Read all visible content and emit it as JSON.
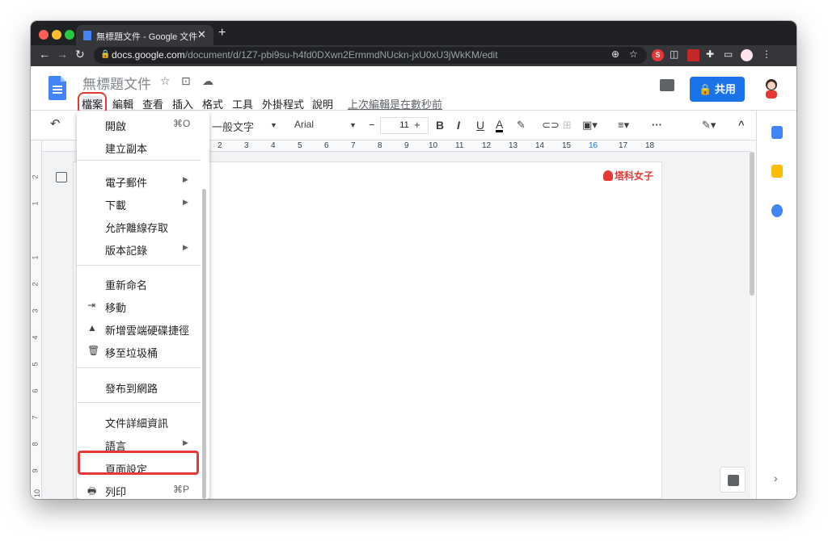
{
  "browser": {
    "tab_title": "無標題文件 - Google 文件",
    "tab_close": "✕",
    "new_tab": "+",
    "url_host": "docs.google.com",
    "url_path": "/document/d/1Z7-pbi9su-h4fd0DXwn2ErmmdNUckn-jxU0xU3jWkKM/edit",
    "back": "←",
    "forward": "→",
    "reload": "↻",
    "lock": "🔒",
    "zoom_icon": "⊕",
    "star_icon": "☆",
    "menu_dots": "⋮"
  },
  "docs": {
    "doc_title": "無標題文件",
    "menu": [
      "檔案",
      "編輯",
      "查看",
      "插入",
      "格式",
      "工具",
      "外掛程式",
      "說明"
    ],
    "last_edit": "上次編輯是在數秒前",
    "share_label": "🔒 共用"
  },
  "toolbar": {
    "undo": "↶",
    "style": "一般文字",
    "font": "Arial",
    "font_size": "11",
    "minus": "−",
    "plus": "+",
    "bold": "B",
    "italic": "I",
    "underline": "U",
    "text_color": "A",
    "more": "···",
    "collapse": "^"
  },
  "ruler": {
    "h_labels": [
      "2",
      "3",
      "4",
      "5",
      "6",
      "7",
      "8",
      "9",
      "10",
      "11",
      "12",
      "13",
      "14",
      "15",
      "16",
      "17",
      "18"
    ],
    "v_labels": [
      "2",
      "1",
      "1",
      "2",
      "3",
      "4",
      "5",
      "6",
      "7",
      "8",
      "9",
      "10"
    ]
  },
  "watermark": "塔科女子",
  "file_menu": {
    "items": [
      {
        "label": "開啟",
        "shortcut": "⌘O"
      },
      {
        "label": "建立副本"
      },
      {
        "label": "電子郵件",
        "arrow": "▶"
      },
      {
        "label": "下載",
        "arrow": "▶"
      },
      {
        "label": "允許離線存取"
      },
      {
        "label": "版本記錄",
        "arrow": "▶"
      },
      {
        "label": "重新命名"
      },
      {
        "label": "移動",
        "icon": "⇥"
      },
      {
        "label": "新增雲端硬碟捷徑",
        "icon": "▲"
      },
      {
        "label": "移至垃圾桶",
        "icon": "🗑"
      },
      {
        "label": "發布到網路"
      },
      {
        "label": "文件詳細資訊"
      },
      {
        "label": "語言",
        "arrow": "▶"
      },
      {
        "label": "頁面設定"
      },
      {
        "label": "列印",
        "shortcut": "⌘P",
        "icon": "🖶"
      }
    ]
  },
  "side": {
    "chevron": "›"
  },
  "colors": {
    "highlight": "#e53935",
    "share_blue": "#1a73e8",
    "docs_blue": "#4285f4"
  }
}
